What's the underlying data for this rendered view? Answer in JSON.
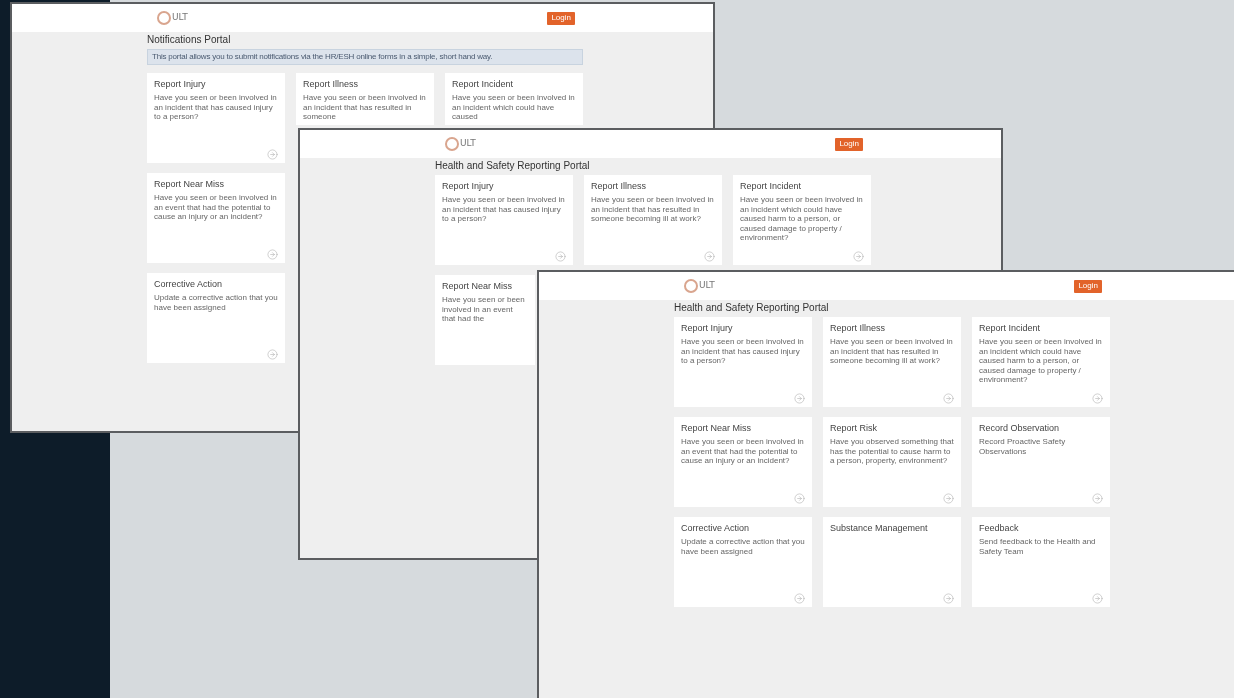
{
  "windows": [
    {
      "logo_text": "ULT",
      "login": "Login",
      "title": "Notifications Portal",
      "banner": "This portal allows you to submit notifications via the HR/ESH online forms in a simple, short hand way.",
      "rows": [
        [
          {
            "kind": "full",
            "title": "Report Injury",
            "description": "Have you seen or been involved in an incident that has caused injury to a person?"
          },
          {
            "kind": "cut_below",
            "title": "Report Illness",
            "description": "Have you seen or been involved in an incident that has resulted in someone"
          },
          {
            "kind": "cut_below",
            "title": "Report Incident",
            "description": "Have you seen or been involved in an incident which could have caused"
          }
        ],
        [
          {
            "kind": "full",
            "title": "Report Near Miss",
            "description": "Have you seen or been involved in an event that had the potential to cause an injury or an incident?"
          }
        ],
        [
          {
            "kind": "full",
            "title": "Corrective Action",
            "description": "Update a corrective action that you have been assigned"
          }
        ]
      ]
    },
    {
      "logo_text": "ULT",
      "login": "Login",
      "title": "Health and Safety Reporting Portal",
      "rows": [
        [
          {
            "kind": "full",
            "title": "Report Injury",
            "description": "Have you seen or been involved in an incident that has caused injury to a person?"
          },
          {
            "kind": "full",
            "title": "Report Illness",
            "description": "Have you seen or been involved in an incident that has resulted in someone becoming ill at work?"
          },
          {
            "kind": "full",
            "title": "Report Incident",
            "description": "Have you seen or been involved in an incident which could have caused harm to a person, or caused damage to property / environment?"
          }
        ],
        [
          {
            "kind": "cut_right",
            "title": "Report Near Miss",
            "description": "Have you seen or been involved in an event that had the"
          }
        ]
      ]
    },
    {
      "logo_text": "ULT",
      "login": "Login",
      "title": "Health and Safety Reporting Portal",
      "rows": [
        [
          {
            "kind": "full",
            "title": "Report Injury",
            "description": "Have you seen or been involved in an incident that has caused injury to a person?"
          },
          {
            "kind": "full",
            "title": "Report Illness",
            "description": "Have you seen or been involved in an incident that has resulted in someone becoming ill at work?"
          },
          {
            "kind": "full",
            "title": "Report Incident",
            "description": "Have you seen or been involved in an incident which could have caused harm to a person, or caused damage to property / environment?"
          }
        ],
        [
          {
            "kind": "full",
            "title": "Report Near Miss",
            "description": "Have you seen or been involved in an event that had the potential to cause an injury or an incident?"
          },
          {
            "kind": "full",
            "title": "Report Risk",
            "description": "Have you observed something that has the potential to cause harm to a person, property, environment?"
          },
          {
            "kind": "full",
            "title": "Record Observation",
            "description": "Record Proactive Safety Observations"
          }
        ],
        [
          {
            "kind": "full",
            "title": "Corrective Action",
            "description": "Update a corrective action that you have been assigned"
          },
          {
            "kind": "full",
            "title": "Substance Management"
          },
          {
            "kind": "full",
            "title": "Feedback",
            "description": "Send feedback to the Health and Safety Team"
          }
        ]
      ]
    }
  ]
}
